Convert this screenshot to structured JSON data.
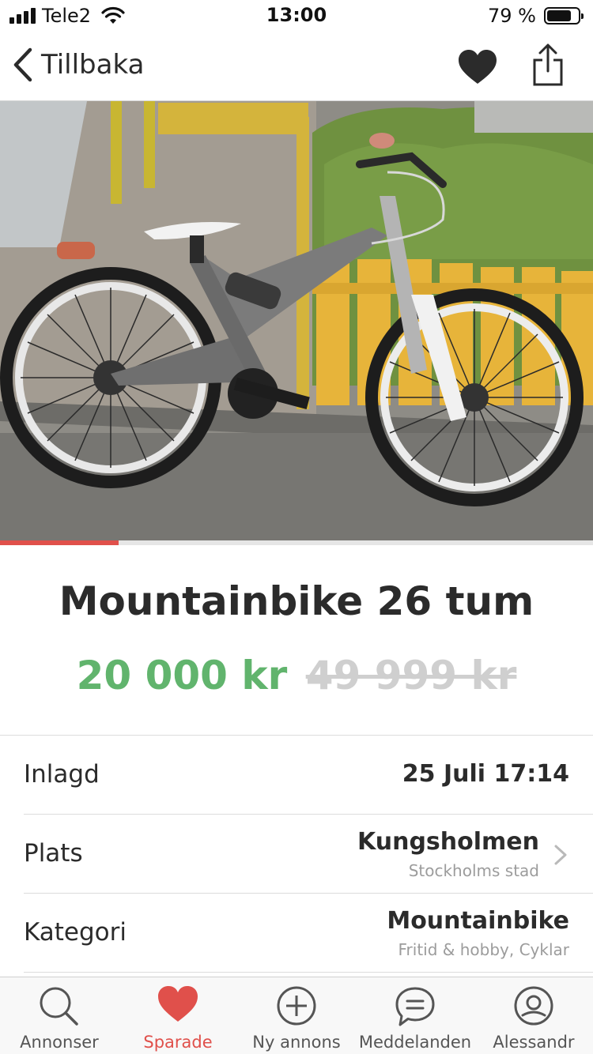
{
  "status_bar": {
    "carrier": "Tele2",
    "time": "13:00",
    "battery_percent": "79 %",
    "battery_level": 0.79
  },
  "nav": {
    "back_label": "Tillbaka",
    "heart_icon": "heart-icon",
    "share_icon": "share-icon"
  },
  "gallery": {
    "progress": 0.2,
    "image_subject": "grey Mongoose full-suspension mountain bike leaning against a yellow wooden fence"
  },
  "listing": {
    "title": "Mountainbike 26 tum",
    "price": "20 000 kr",
    "old_price": "49 999 kr",
    "price_color": "#61b46d",
    "accent_color": "#e0504b"
  },
  "details": {
    "posted_label": "Inlagd",
    "posted_value": "25 Juli 17:14",
    "location_label": "Plats",
    "location_value": "Kungsholmen",
    "location_sub": "Stockholms stad",
    "category_label": "Kategori",
    "category_value": "Mountainbike",
    "category_sub": "Fritid & hobby, Cyklar"
  },
  "tabs": [
    {
      "label": "Annonser",
      "icon": "search-icon",
      "active": false
    },
    {
      "label": "Sparade",
      "icon": "heart-icon",
      "active": true
    },
    {
      "label": "Ny annons",
      "icon": "plus-circle-icon",
      "active": false
    },
    {
      "label": "Meddelanden",
      "icon": "chat-icon",
      "active": false
    },
    {
      "label": "Alessandr",
      "icon": "profile-icon",
      "active": false
    }
  ]
}
